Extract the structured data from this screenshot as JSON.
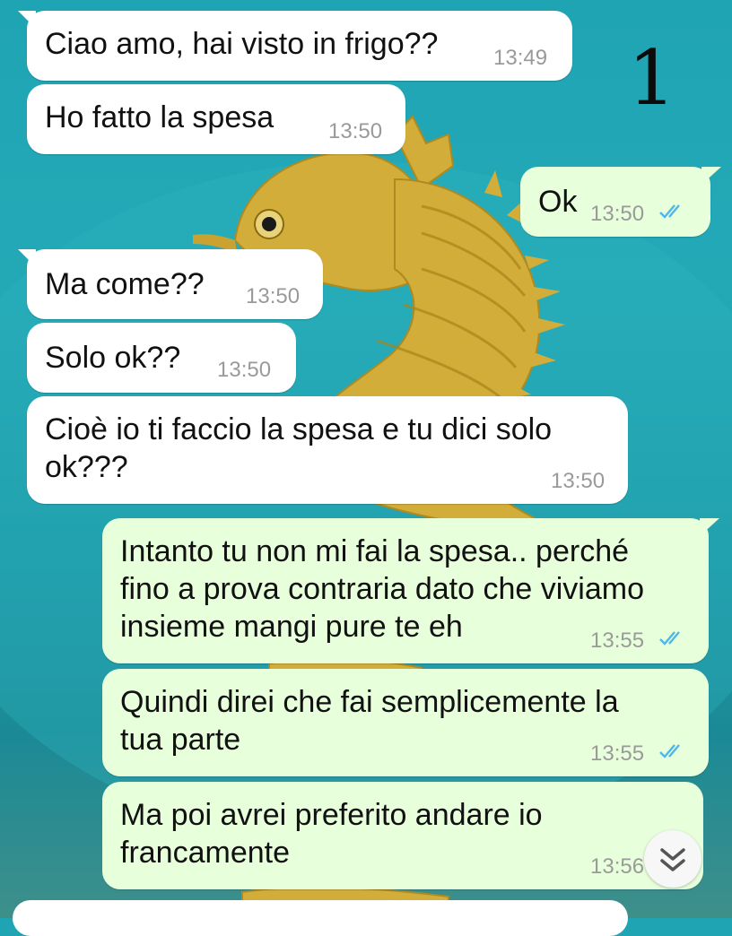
{
  "annotation_mark": "1",
  "messages": [
    {
      "text": "Ciao amo, hai visto in frigo??",
      "time": "13:49",
      "direction": "incoming"
    },
    {
      "text": "Ho fatto la spesa",
      "time": "13:50",
      "direction": "incoming"
    },
    {
      "text": "Ok",
      "time": "13:50",
      "direction": "outgoing",
      "status": "read"
    },
    {
      "text": "Ma come??",
      "time": "13:50",
      "direction": "incoming"
    },
    {
      "text": "Solo ok??",
      "time": "13:50",
      "direction": "incoming"
    },
    {
      "text": "Cioè io ti faccio la spesa e tu dici solo\nok???",
      "time": "13:50",
      "direction": "incoming"
    },
    {
      "text": "Intanto tu non mi fai la spesa.. perché\nfino a prova contraria dato che viviamo\ninsieme mangi pure te eh",
      "time": "13:55",
      "direction": "outgoing",
      "status": "read"
    },
    {
      "text": "Quindi direi che fai semplicemente la\ntua parte",
      "time": "13:55",
      "direction": "outgoing",
      "status": "read"
    },
    {
      "text": "Ma poi avrei preferito andare io\nfrancamente",
      "time": "13:56",
      "direction": "outgoing"
    }
  ],
  "icons": {
    "read_ticks": "double-check-icon",
    "scroll_down": "chevron-double-down-icon"
  },
  "colors": {
    "incoming_bubble": "#ffffff",
    "outgoing_bubble": "#e7ffdb",
    "read_ticks": "#4fb6ec",
    "timestamp": "#9a9a9a"
  }
}
